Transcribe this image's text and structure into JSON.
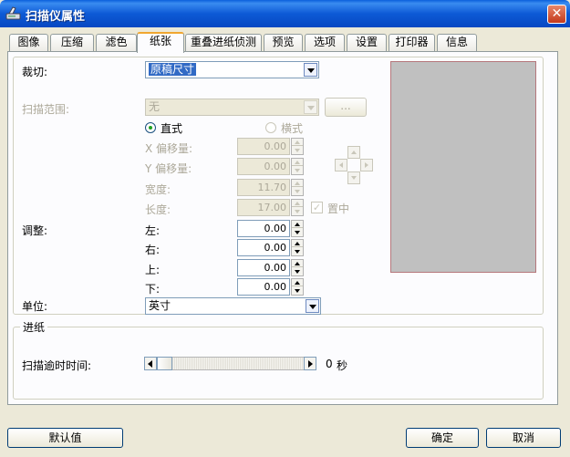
{
  "window": {
    "title": "扫描仪属性",
    "close_symbol": "✕"
  },
  "tabs": [
    {
      "label": "图像"
    },
    {
      "label": "压缩"
    },
    {
      "label": "滤色"
    },
    {
      "label": "纸张",
      "active": true
    },
    {
      "label": "重叠进纸侦测"
    },
    {
      "label": "预览"
    },
    {
      "label": "选项"
    },
    {
      "label": "设置"
    },
    {
      "label": "打印器"
    },
    {
      "label": "信息"
    }
  ],
  "crop": {
    "label": "裁切:",
    "value": "原稿尺寸"
  },
  "scan_area": {
    "label": "扫描范围:",
    "value": "无",
    "button_label": "..."
  },
  "orientation": {
    "portrait": "直式",
    "landscape": "横式",
    "selected": "portrait"
  },
  "offsets": {
    "x_label": "X 偏移量:",
    "x_value": "0.00",
    "y_label": "Y 偏移量:",
    "y_value": "0.00",
    "width_label": "宽度:",
    "width_value": "11.70",
    "length_label": "长度:",
    "length_value": "17.00",
    "center_label": "置中",
    "center_checked": true
  },
  "adjust": {
    "label": "调整:",
    "left_label": "左:",
    "left_value": "0.00",
    "right_label": "右:",
    "right_value": "0.00",
    "top_label": "上:",
    "top_value": "0.00",
    "bottom_label": "下:",
    "bottom_value": "0.00"
  },
  "unit": {
    "label": "单位:",
    "value": "英寸"
  },
  "feed": {
    "group_label": "进纸",
    "timeout_label": "扫描逾时时间:",
    "timeout_value": "0",
    "timeout_unit": "秒"
  },
  "footer": {
    "default_label": "默认值",
    "ok_label": "确定",
    "cancel_label": "取消"
  },
  "colors": {
    "titlebar": "#0a5fdc",
    "selection": "#316ac5",
    "preview": "#c0c0c0",
    "dialog_bg": "#ece9d8"
  }
}
